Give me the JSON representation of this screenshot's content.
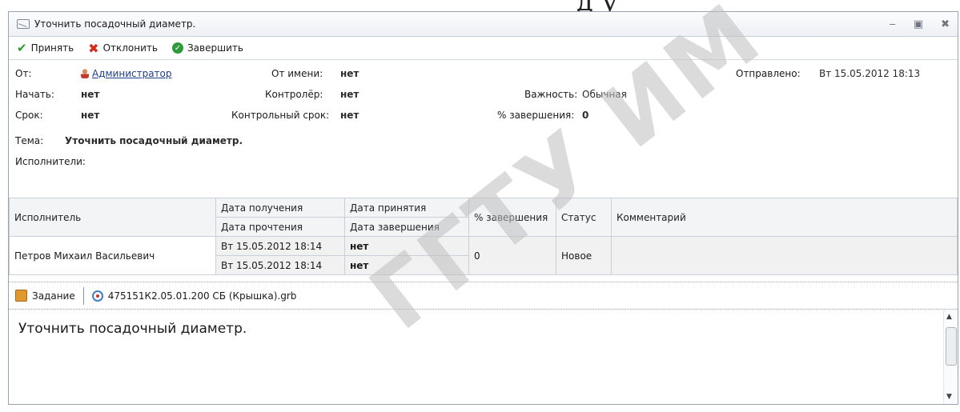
{
  "background": {
    "top_text": "д    у",
    "watermark": "ГГТУ ИМ"
  },
  "window": {
    "title": "Уточнить посадочный диаметр."
  },
  "toolbar": {
    "accept": "Принять",
    "decline": "Отклонить",
    "finish": "Завершить"
  },
  "info": {
    "from_label": "От:",
    "from_value": "Администратор",
    "on_behalf_label": "От имени:",
    "on_behalf_value": "нет",
    "sent_label": "Отправлено:",
    "sent_value": "Вт 15.05.2012 18:13",
    "start_label": "Начать:",
    "start_value": "нет",
    "controller_label": "Контролёр:",
    "controller_value": "нет",
    "importance_label": "Важность:",
    "importance_value": "Обычная",
    "deadline_label": "Срок:",
    "deadline_value": "нет",
    "control_deadline_label": "Контрольный срок:",
    "control_deadline_value": "нет",
    "completion_label": "% завершения:",
    "completion_value": "0",
    "subject_label": "Тема:",
    "subject_value": "Уточнить посадочный диаметр.",
    "executors_label": "Исполнители:"
  },
  "table": {
    "headers": {
      "executor": "Исполнитель",
      "received": "Дата получения",
      "read": "Дата прочтения",
      "accepted": "Дата принятия",
      "completed": "Дата завершения",
      "completion": "% завершения",
      "status": "Статус",
      "comment": "Комментарий"
    },
    "rows": [
      {
        "executor": "Петров Михаил Васильевич",
        "received": "Вт 15.05.2012 18:14",
        "read": "Вт 15.05.2012 18:14",
        "accepted": "нет",
        "completed": "нет",
        "completion": "0",
        "status": "Новое",
        "comment": ""
      }
    ]
  },
  "tabs": {
    "task": "Задание",
    "file": "475151К2.05.01.200 СБ (Крышка).grb"
  },
  "body_text": "Уточнить посадочный диаметр."
}
